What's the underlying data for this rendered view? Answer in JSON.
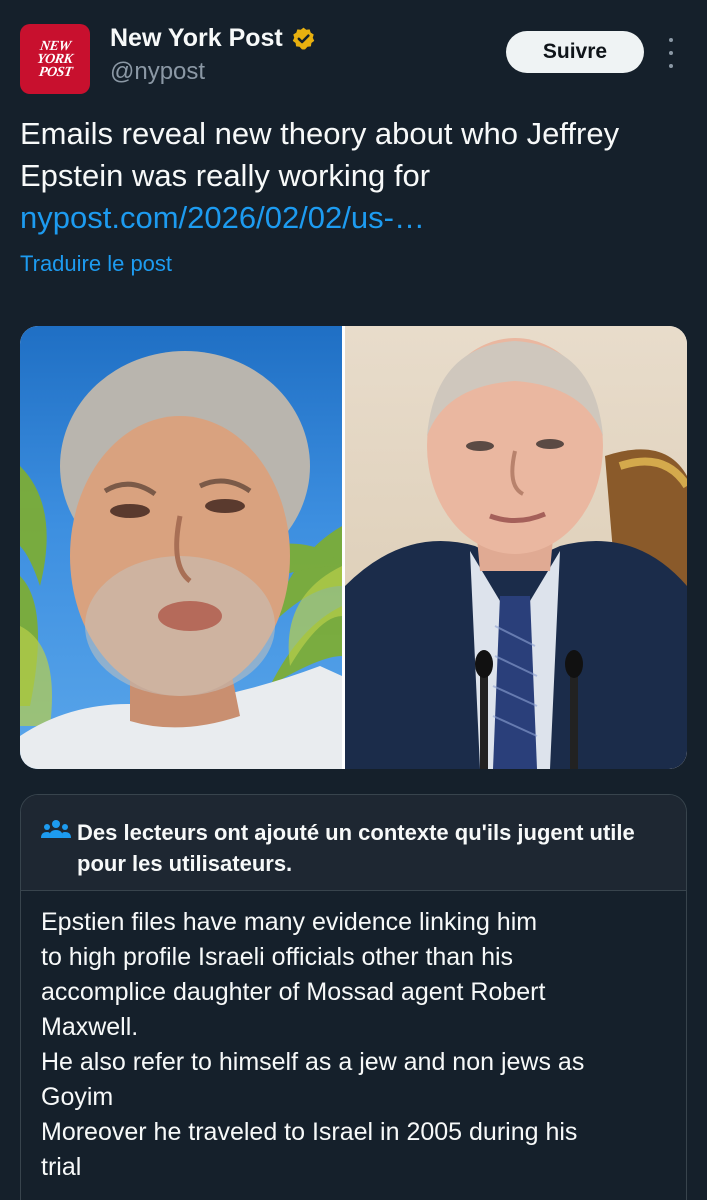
{
  "author": {
    "logo_lines": [
      "NEW",
      "YORK",
      "POST"
    ],
    "display_name": "New York Post",
    "handle": "@nypost",
    "verified_icon": "verified-badge-gold-icon",
    "verified_color": "#e8b00f",
    "logo_color": "#c8102e"
  },
  "actions": {
    "follow_label": "Suivre",
    "more_icon": "vertical-dots-icon"
  },
  "post": {
    "text": "Emails reveal new theory about who Jeffrey Epstein was really working for ",
    "link_text": "nypost.com/2026/02/02/us-…",
    "translate_label": "Traduire le post"
  },
  "media": {
    "left_image": "selfie-photo-man-palm-trees",
    "right_image": "photo-man-suit-tie-microphones"
  },
  "community_note": {
    "icon": "people-icon",
    "title": "Des lecteurs ont ajouté un contexte qu'ils jugent utile pour les utilisateurs.",
    "body": "Epstien files have many evidence linking him\nto high profile Israeli officials other than his\naccomplice daughter of Mossad agent Robert\nMaxwell.\nHe also refer to himself as a jew and non jews as\nGoyim\nMoreover he traveled to Israel in 2005 during his\ntrial"
  },
  "colors": {
    "background": "#15202b",
    "link": "#1d9bf0",
    "secondary_text": "#8b98a5",
    "border": "#38444d"
  }
}
